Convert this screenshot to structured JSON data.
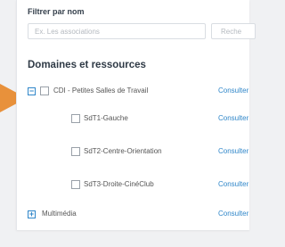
{
  "filter": {
    "label": "Filtrer par nom",
    "placeholder": "Ex. Les associations",
    "button_label": "Reche"
  },
  "section": {
    "title": "Domaines et ressources"
  },
  "tree": [
    {
      "label": "CDI - Petites Salles de Travail",
      "link": "Consulter",
      "toggle": "−",
      "checkbox": true,
      "level": 0
    },
    {
      "label": "SdT1-Gauche",
      "link": "Consulter",
      "checkbox": true,
      "level": 1
    },
    {
      "label": "SdT2-Centre-Orientation",
      "link": "Consulter",
      "checkbox": true,
      "level": 1
    },
    {
      "label": "SdT3-Droite-CinéClub",
      "link": "Consulter",
      "checkbox": true,
      "level": 1
    },
    {
      "label": "Multimédia",
      "link": "Consulter",
      "toggle": "+",
      "checkbox": false,
      "level": 0
    }
  ],
  "colors": {
    "accent": "#2f86c9",
    "arrow": "#e8913b"
  }
}
